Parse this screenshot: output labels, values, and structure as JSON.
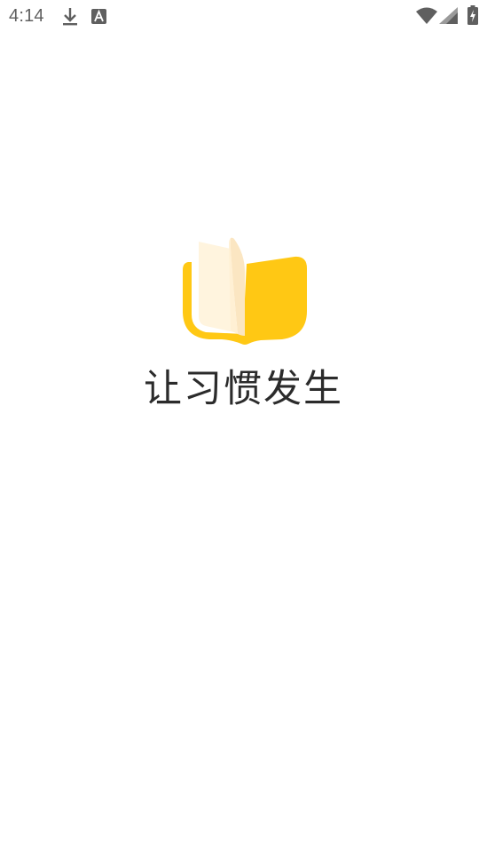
{
  "status_bar": {
    "time": "4:14",
    "icons": [
      "download-icon",
      "a-notification-icon",
      "wifi-icon",
      "cell-signal-icon",
      "battery-charging-icon"
    ]
  },
  "splash": {
    "logo": "open-book-logo",
    "slogan": "让习惯发生"
  },
  "colors": {
    "brand_yellow": "#FFC814",
    "page_light": "#FFF4DE",
    "page_mid": "#FBE6C2",
    "status_gray": "#5F5F5F",
    "slogan_text": "#2B2B2B",
    "background": "#FFFFFF"
  }
}
